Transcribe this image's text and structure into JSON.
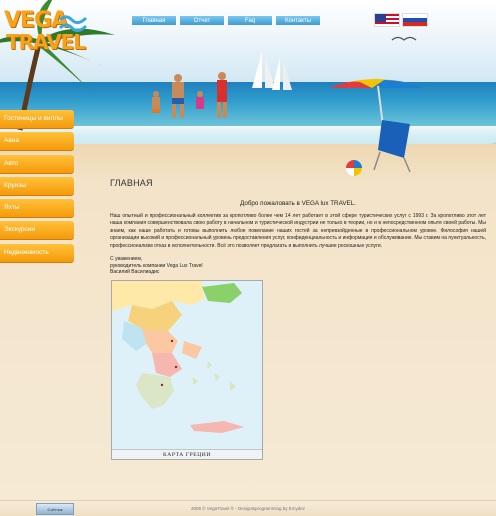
{
  "brand": {
    "line1": "VEGA",
    "line2": "TRAVEL"
  },
  "topnav": [
    {
      "label": "Главная"
    },
    {
      "label": "Отчет"
    },
    {
      "label": "Faq"
    },
    {
      "label": "Контакты"
    }
  ],
  "languages": [
    {
      "name": "flag-us-icon"
    },
    {
      "name": "flag-ru-icon"
    }
  ],
  "sidebar": {
    "items": [
      {
        "label": "Гостиницы и виллы"
      },
      {
        "label": "Авиа"
      },
      {
        "label": "Авто"
      },
      {
        "label": "Круизы"
      },
      {
        "label": "Яхты"
      },
      {
        "label": "Экскурсии"
      },
      {
        "label": "Недвижимость"
      }
    ]
  },
  "content": {
    "title": "ГЛАВНАЯ",
    "welcome": "Добро пожаловать в VEGA lux TRAVEL.",
    "paragraph": "Наш опытный и профессиональный коллектив за кропотливо более чем 14 лет работает в этой сфере туристических услуг с 1993 г. За кропотливо этот лет наша компания совершенствовала свою работу в начальном и туристической индустрии не только в теории, но и в непосредственном опыте своей работы. Мы знаем, как наше работать и готовы выполнить любое пожелание наших гостей за непревзойденные в профессиональном уровне. Философия нашей организации высокий и профессиональный уровень предоставления услуг, конфиденциальность и информация и обслуживание. Мы ставим на пунктуальность, профессионализм отказ в исполнительности. Всё это позволяет предлагать и выполнить лучшие роскошные услуги.",
    "sign_1": "С уважением,",
    "sign_2": "руководитель компании Vega Lux Travel",
    "sign_3": "Василий Василиадис"
  },
  "map": {
    "caption": "КАРТА ГРЕЦИИ"
  },
  "footer": {
    "text": "2008 © VegaTravel ® - Design&programming by Emydez",
    "badge": "Счётчик"
  },
  "colors": {
    "accent": "#f59a0a",
    "nav": "#3c9dd6"
  }
}
